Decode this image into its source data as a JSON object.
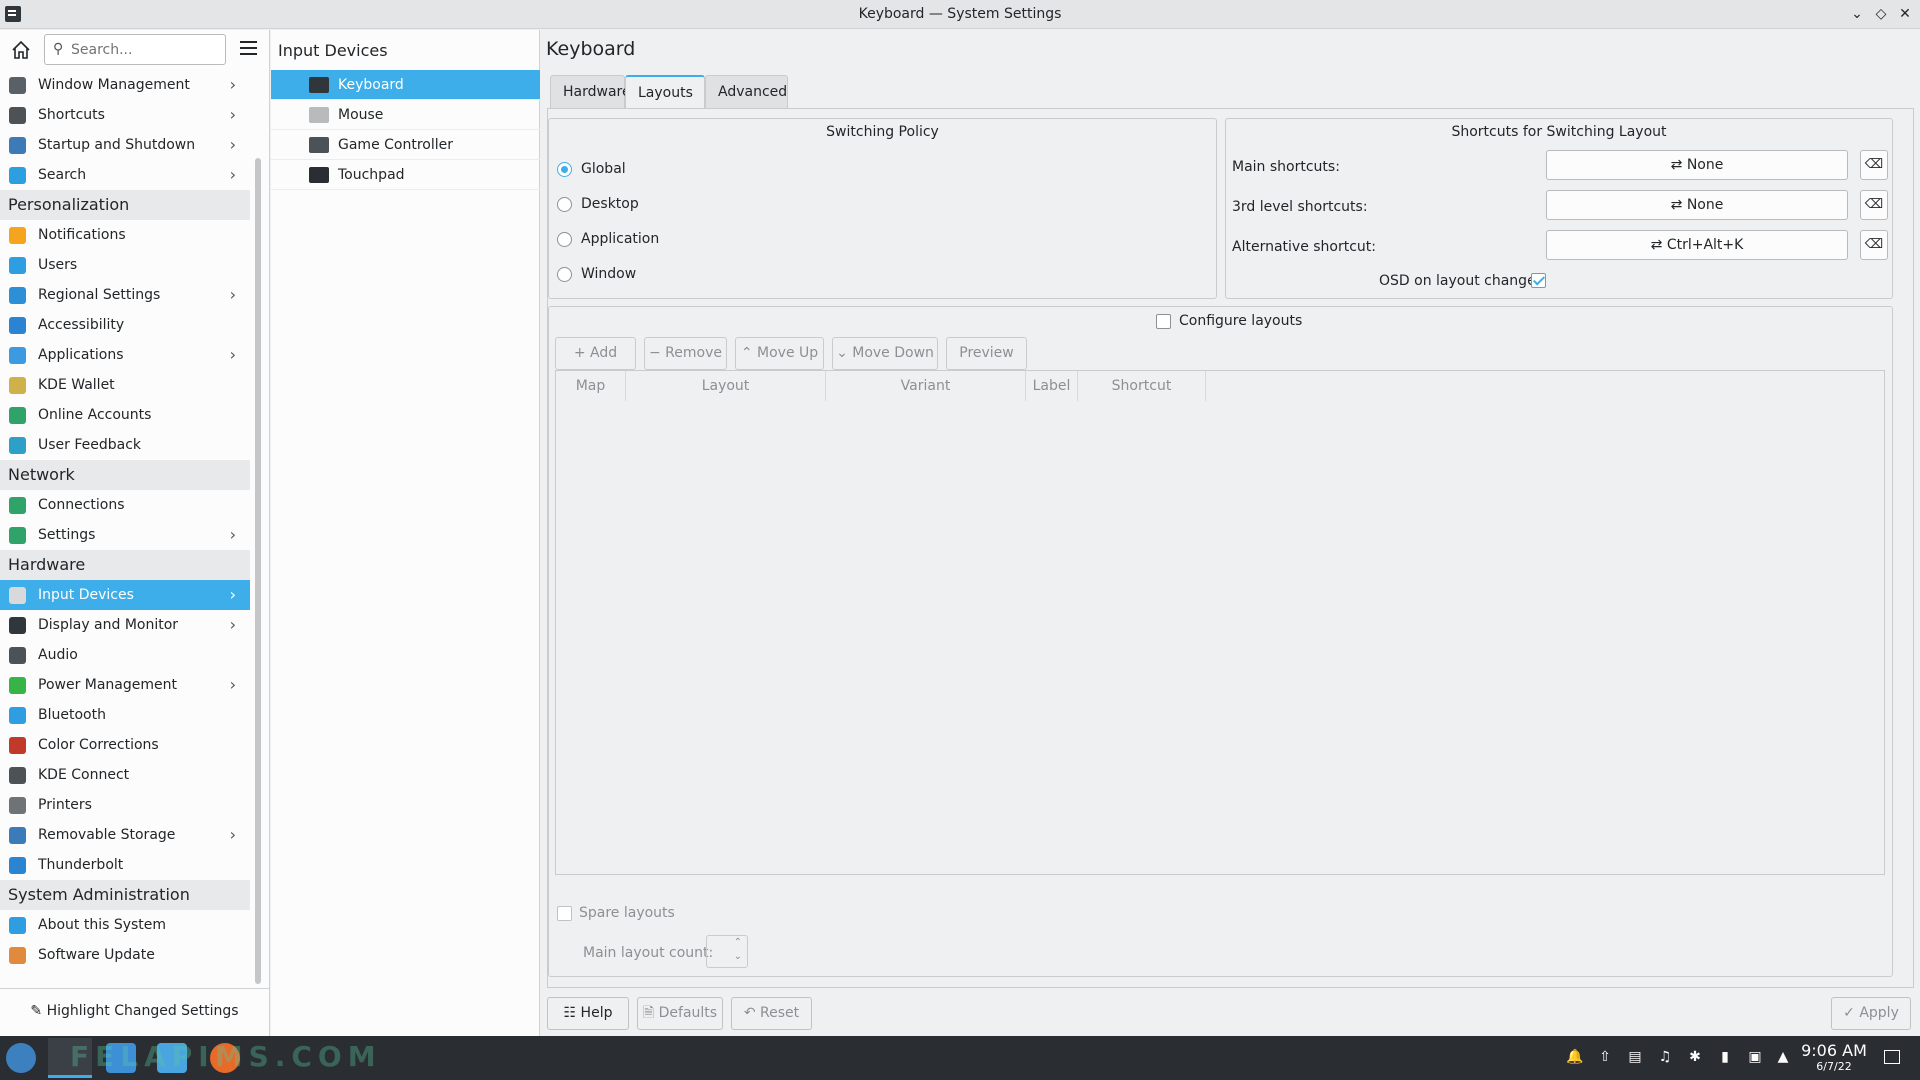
{
  "window": {
    "title": "Keyboard — System Settings"
  },
  "sidebar": {
    "search_placeholder": "Search...",
    "items": [
      {
        "label": "Window Management",
        "type": "item",
        "chevron": true,
        "color": "#5a6068"
      },
      {
        "label": "Shortcuts",
        "type": "item",
        "chevron": true,
        "color": "#4d5257"
      },
      {
        "label": "Startup and Shutdown",
        "type": "item",
        "chevron": true,
        "color": "#3d7ab8"
      },
      {
        "label": "Search",
        "type": "item",
        "chevron": true,
        "color": "#2b9fe0"
      },
      {
        "label": "Personalization",
        "type": "category"
      },
      {
        "label": "Notifications",
        "type": "item",
        "chevron": false,
        "color": "#f4a41d"
      },
      {
        "label": "Users",
        "type": "item",
        "chevron": false,
        "color": "#2f9ee0"
      },
      {
        "label": "Regional Settings",
        "type": "item",
        "chevron": true,
        "color": "#2d8fd6"
      },
      {
        "label": "Accessibility",
        "type": "item",
        "chevron": false,
        "color": "#2a84d2"
      },
      {
        "label": "Applications",
        "type": "item",
        "chevron": true,
        "color": "#3d9ae0"
      },
      {
        "label": "KDE Wallet",
        "type": "item",
        "chevron": false,
        "color": "#d0b04a"
      },
      {
        "label": "Online Accounts",
        "type": "item",
        "chevron": false,
        "color": "#2fa36a"
      },
      {
        "label": "User Feedback",
        "type": "item",
        "chevron": false,
        "color": "#2ea0c8"
      },
      {
        "label": "Network",
        "type": "category"
      },
      {
        "label": "Connections",
        "type": "item",
        "chevron": false,
        "color": "#2fa36a"
      },
      {
        "label": "Settings",
        "type": "item",
        "chevron": true,
        "color": "#2fa36a"
      },
      {
        "label": "Hardware",
        "type": "category"
      },
      {
        "label": "Input Devices",
        "type": "item",
        "chevron": true,
        "color": "#d7d9db",
        "active": true
      },
      {
        "label": "Display and Monitor",
        "type": "item",
        "chevron": true,
        "color": "#31363b"
      },
      {
        "label": "Audio",
        "type": "item",
        "chevron": false,
        "color": "#4d5257"
      },
      {
        "label": "Power Management",
        "type": "item",
        "chevron": true,
        "color": "#37b34a"
      },
      {
        "label": "Bluetooth",
        "type": "item",
        "chevron": false,
        "color": "#2f9ee0"
      },
      {
        "label": "Color Corrections",
        "type": "item",
        "chevron": false,
        "color": "#c0392b"
      },
      {
        "label": "KDE Connect",
        "type": "item",
        "chevron": false,
        "color": "#4d5257"
      },
      {
        "label": "Printers",
        "type": "item",
        "chevron": false,
        "color": "#6e7378"
      },
      {
        "label": "Removable Storage",
        "type": "item",
        "chevron": true,
        "color": "#3d7ab8"
      },
      {
        "label": "Thunderbolt",
        "type": "item",
        "chevron": false,
        "color": "#2a84d2"
      },
      {
        "label": "System Administration",
        "type": "category"
      },
      {
        "label": "About this System",
        "type": "item",
        "chevron": false,
        "color": "#2f9ee0"
      },
      {
        "label": "Software Update",
        "type": "item",
        "chevron": false,
        "color": "#e08a3c"
      }
    ],
    "footer_label": "Highlight Changed Settings"
  },
  "middle": {
    "title": "Input Devices",
    "items": [
      {
        "label": "Keyboard",
        "active": true,
        "color": "#31363b"
      },
      {
        "label": "Mouse",
        "active": false,
        "color": "#b8babc"
      },
      {
        "label": "Game Controller",
        "active": false,
        "color": "#4d5257"
      },
      {
        "label": "Touchpad",
        "active": false,
        "color": "#2a2e32"
      }
    ]
  },
  "main": {
    "title": "Keyboard",
    "tabs": [
      "Hardware",
      "Layouts",
      "Advanced"
    ],
    "switching": {
      "title": "Switching Policy",
      "options": [
        "Global",
        "Desktop",
        "Application",
        "Window"
      ],
      "selected": "Global"
    },
    "shortcuts": {
      "title": "Shortcuts for Switching Layout",
      "rows": [
        {
          "label": "Main shortcuts:",
          "value": "None"
        },
        {
          "label": "3rd level shortcuts:",
          "value": "None"
        },
        {
          "label": "Alternative shortcut:",
          "value": "Ctrl+Alt+K"
        }
      ],
      "osd_label": "OSD on layout change",
      "osd_checked": true
    },
    "configure_label": "Configure layouts",
    "toolbar": [
      "Add",
      "Remove",
      "Move Up",
      "Move Down",
      "Preview"
    ],
    "columns": [
      "Map",
      "Layout",
      "Variant",
      "Label",
      "Shortcut"
    ],
    "spare_label": "Spare layouts",
    "main_count_label": "Main layout count:",
    "buttons": {
      "help": "Help",
      "defaults": "Defaults",
      "reset": "Reset",
      "apply": "Apply"
    }
  },
  "taskbar": {
    "time": "9:06 AM",
    "date": "6/7/22",
    "watermark": "FELAPIMS.COM"
  }
}
